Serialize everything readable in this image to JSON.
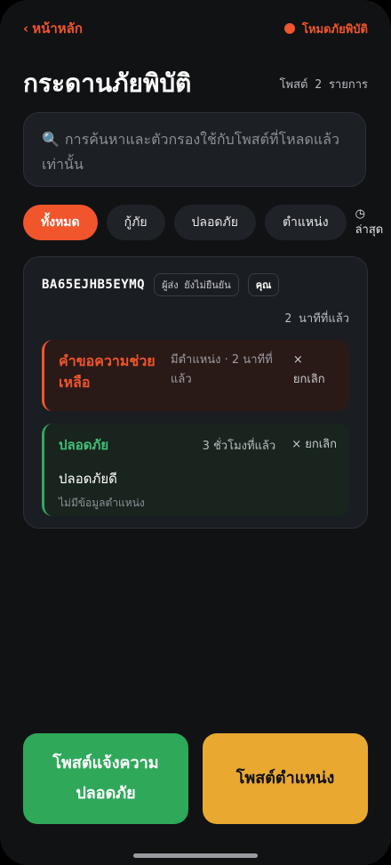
{
  "topbar": {
    "back_label": "หน้าหลัก",
    "mode_label": "โหมดภัยพิบัติ"
  },
  "header": {
    "title": "กระดานภัยพิบัติ",
    "post_count": "โพสต์ 2 รายการ"
  },
  "search": {
    "placeholder": "การค้นหาและตัวกรองใช้กับโพสต์ที่โหลดแล้วเท่านั้น"
  },
  "filters": [
    {
      "label": "ทั้งหมด",
      "active": true
    },
    {
      "label": "กู้ภัย",
      "active": false
    },
    {
      "label": "ปลอดภัย",
      "active": false
    },
    {
      "label": "ตำแหน่ง",
      "active": false
    }
  ],
  "sort": {
    "icon": "clock-icon",
    "label": "ล่าสุด"
  },
  "card": {
    "user_id": "BA65EJHB5EYMQ",
    "sender_badge": "ผู้ส่ง ยังไม่ยืนยัน",
    "you_badge": "คุณ",
    "time": "2 นาทีที่แล้ว",
    "help": {
      "title": "คำขอความช่วยเหลือ",
      "meta": "มีตำแหน่ง · 2 นาทีที่แล้ว",
      "cancel": "× ยกเลิก"
    },
    "safe": {
      "title": "ปลอดภัย",
      "meta": "3 ชั่วโมงที่แล้ว",
      "cancel": "× ยกเลิก",
      "body": "ปลอดภัยดี",
      "sub": "ไม่มีข้อมูลตำแหน่ง"
    }
  },
  "buttons": {
    "safe_post": "โพสต์แจ้งความปลอดภัย",
    "location_post": "โพสต์ตำแหน่ง"
  },
  "colors": {
    "accent": "#f0552b",
    "safe": "#2fa85a",
    "location": "#e9a930"
  }
}
